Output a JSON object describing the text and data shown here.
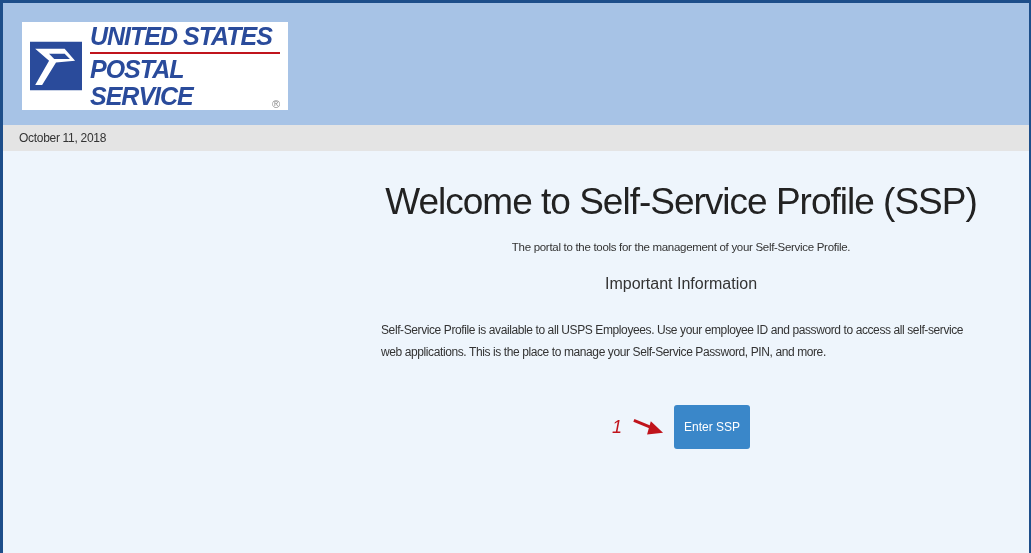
{
  "logo": {
    "line_1": "UNITED STATES",
    "line_2": "POSTAL SERVICE",
    "mark": "®"
  },
  "date": "October 11, 2018",
  "title": "Welcome to Self-Service Profile (SSP)",
  "subtitle": "The portal to the tools for the management of your Self-Service Profile.",
  "section_heading": "Important Information",
  "info": "Self-Service Profile is available to all USPS Employees. Use your employee ID and password to access all self-service web applications. This is the place to manage your Self-Service Password, PIN, and more.",
  "step_number": "1",
  "button": "Enter SSP"
}
